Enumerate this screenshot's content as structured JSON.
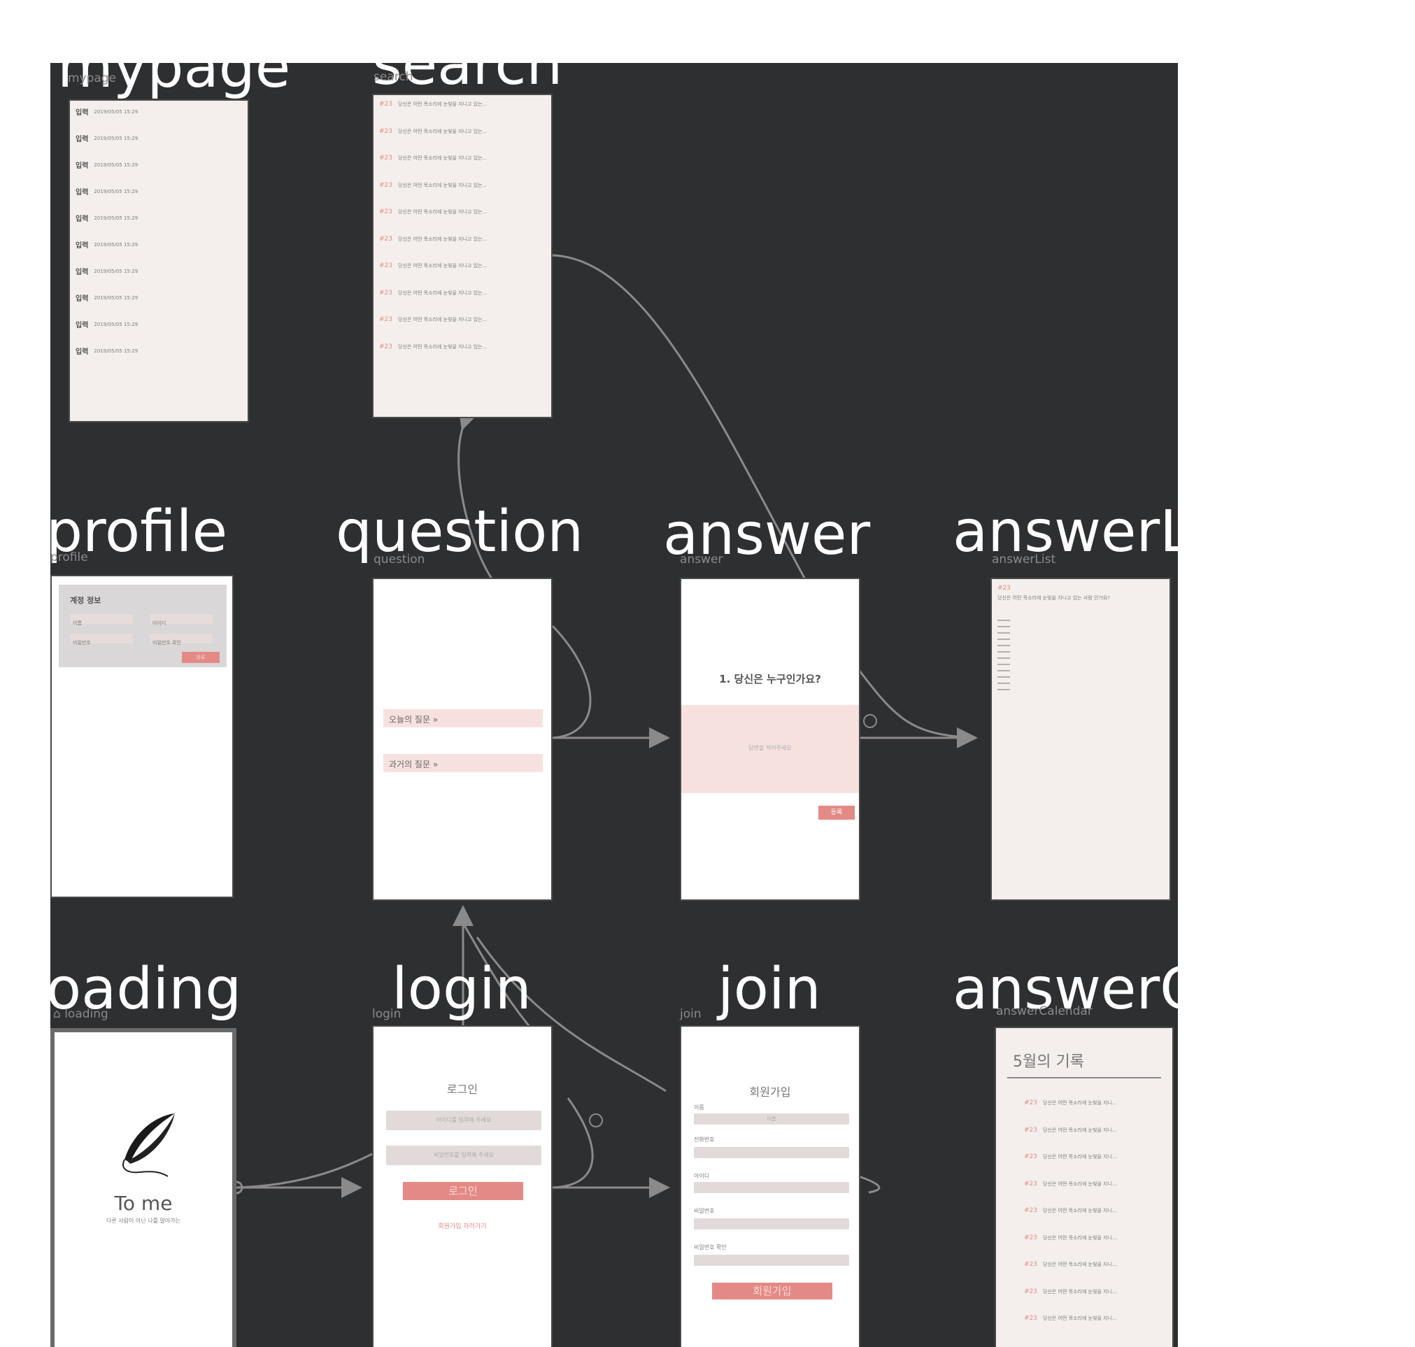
{
  "colors": {
    "canvas_bg": "#2e2f31",
    "accent": "#e48a86",
    "cream": "#f4efec",
    "pink_block": "#f7e1df",
    "field": "#e2dada"
  },
  "labels": {
    "mypage": "mypage",
    "search": "search",
    "profile": "profile",
    "question": "question",
    "answer": "answer",
    "answerList": "answerLi",
    "loading": "oading",
    "login": "login",
    "join": "join",
    "answerCalendar": "answerC"
  },
  "small_labels": {
    "mypage": "mypage",
    "search": "search",
    "profile": "profile",
    "question": "question",
    "answer": "answer",
    "answerList": "answerList",
    "loading": "loading",
    "login": "login",
    "join": "join",
    "answerCalendar": "answerCalendar"
  },
  "mypage": {
    "rows": [
      {
        "tag": "입력",
        "date": "2019/05/05 15:29"
      },
      {
        "tag": "입력",
        "date": "2019/05/05 15:29"
      },
      {
        "tag": "입력",
        "date": "2019/05/05 15:29"
      },
      {
        "tag": "입력",
        "date": "2019/05/05 15:29"
      },
      {
        "tag": "입력",
        "date": "2019/05/05 15:29"
      },
      {
        "tag": "입력",
        "date": "2019/05/05 15:29"
      },
      {
        "tag": "입력",
        "date": "2019/05/05 15:29"
      },
      {
        "tag": "입력",
        "date": "2019/05/05 15:29"
      },
      {
        "tag": "입력",
        "date": "2019/05/05 15:29"
      },
      {
        "tag": "입력",
        "date": "2019/05/05 15:29"
      }
    ]
  },
  "search": {
    "rows": [
      {
        "num": "#23",
        "text": "당신은 어떤 목소리에 눈빛을 지니고 있는..."
      },
      {
        "num": "#23",
        "text": "당신은 어떤 목소리에 눈빛을 지니고 있는..."
      },
      {
        "num": "#23",
        "text": "당신은 어떤 목소리에 눈빛을 지니고 있는..."
      },
      {
        "num": "#23",
        "text": "당신은 어떤 목소리에 눈빛을 지니고 있는..."
      },
      {
        "num": "#23",
        "text": "당신은 어떤 목소리에 눈빛을 지니고 있는..."
      },
      {
        "num": "#23",
        "text": "당신은 어떤 목소리에 눈빛을 지니고 있는..."
      },
      {
        "num": "#23",
        "text": "당신은 어떤 목소리에 눈빛을 지니고 있는..."
      },
      {
        "num": "#23",
        "text": "당신은 어떤 목소리에 눈빛을 지니고 있는..."
      },
      {
        "num": "#23",
        "text": "당신은 어떤 목소리에 눈빛을 지니고 있는..."
      },
      {
        "num": "#23",
        "text": "당신은 어떤 목소리에 눈빛을 지니고 있는..."
      }
    ]
  },
  "profile": {
    "title": "계정 정보",
    "field_name": "이름",
    "field_id": "아이디",
    "field_password": "비밀번호",
    "field_password_check": "비밀번호 확인",
    "button": "완료"
  },
  "question": {
    "today": "오늘의 질문 »",
    "past": "과거의 질문 »"
  },
  "answer": {
    "question": "1. 당신은 누구인가요?",
    "placeholder": "답변을 적어주세요",
    "submit": "등록"
  },
  "answerList": {
    "num": "#23",
    "question": "당신은 어떤 목소리에 눈빛을 지니고 있는 사람 인가요?"
  },
  "loading": {
    "app_name": "To me",
    "tagline": "다른 사람이 아닌 나를 알아가는"
  },
  "login": {
    "title": "로그인",
    "id_placeholder": "아이디를 입력해 주세요",
    "pw_placeholder": "비밀번호를 입력해 주세요",
    "button": "로그인",
    "join_link": "회원가입 하러가기"
  },
  "join": {
    "title": "회원가입",
    "name_label": "이름",
    "name_value": "이름",
    "phone_label": "전화번호",
    "id_label": "아이디",
    "pw_label": "비밀번호",
    "pw_check_label": "비밀번호 확인",
    "button": "회원가입"
  },
  "answerCalendar": {
    "title": "5월의 기록",
    "rows": [
      {
        "num": "#23",
        "text": "당신은 어떤 목소리에 눈빛을 지니..."
      },
      {
        "num": "#23",
        "text": "당신은 어떤 목소리에 눈빛을 지니..."
      },
      {
        "num": "#23",
        "text": "당신은 어떤 목소리에 눈빛을 지니..."
      },
      {
        "num": "#23",
        "text": "당신은 어떤 목소리에 눈빛을 지니..."
      },
      {
        "num": "#23",
        "text": "당신은 어떤 목소리에 눈빛을 지니..."
      },
      {
        "num": "#23",
        "text": "당신은 어떤 목소리에 눈빛을 지니..."
      },
      {
        "num": "#23",
        "text": "당신은 어떤 목소리에 눈빛을 지니..."
      },
      {
        "num": "#23",
        "text": "당신은 어떤 목소리에 눈빛을 지니..."
      },
      {
        "num": "#23",
        "text": "당신은 어떤 목소리에 눈빛을 지니..."
      }
    ]
  }
}
